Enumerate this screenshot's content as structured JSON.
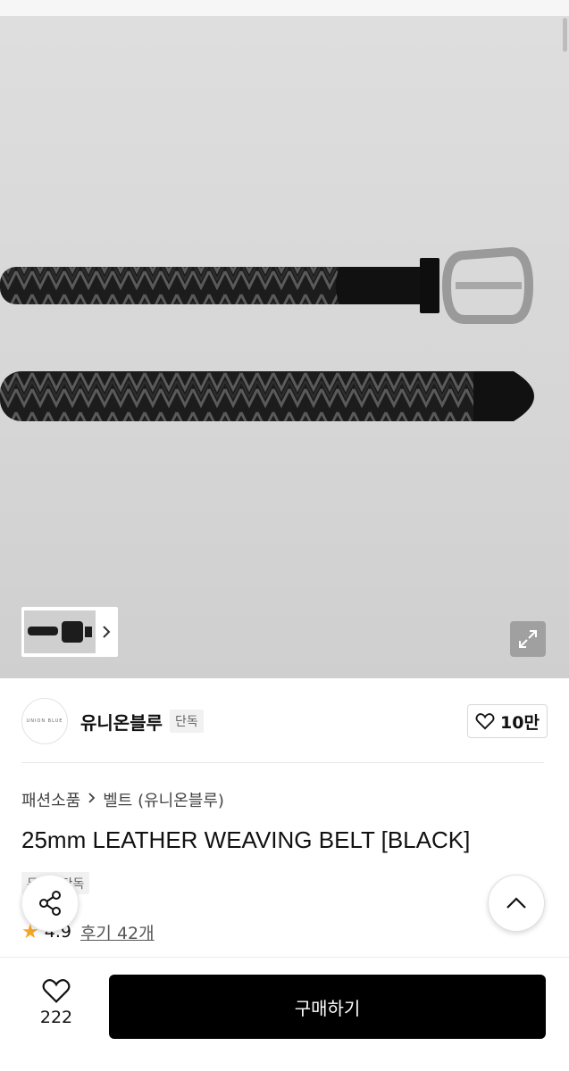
{
  "hero": {
    "image_desc": "black-woven-leather-belt-with-silver-buckle"
  },
  "gallery": {
    "next_icon": "chevron-right-icon",
    "expand_icon": "expand-icon"
  },
  "brand": {
    "logo_text": "UNION BLUE",
    "name": "유니온블루",
    "badge": "단독",
    "like_icon": "heart-outline-icon",
    "like_count": "10만"
  },
  "breadcrumb": {
    "items": [
      "패션소품",
      "벨트 (유니온블루)"
    ],
    "separator_icon": "chevron-right-icon"
  },
  "product": {
    "title": "25mm LEATHER WEAVING BELT [BLACK]",
    "badge": "무신사단독",
    "rating": "4.9",
    "review_label": "후기 42개"
  },
  "floating": {
    "share_icon": "share-icon",
    "top_icon": "chevron-up-icon"
  },
  "bottom": {
    "wish_icon": "heart-outline-icon",
    "wish_count": "222",
    "buy_label": "구매하기"
  },
  "colors": {
    "accent": "#000000",
    "star": "#f5a623",
    "hero_bg": "#d8d8d8"
  }
}
